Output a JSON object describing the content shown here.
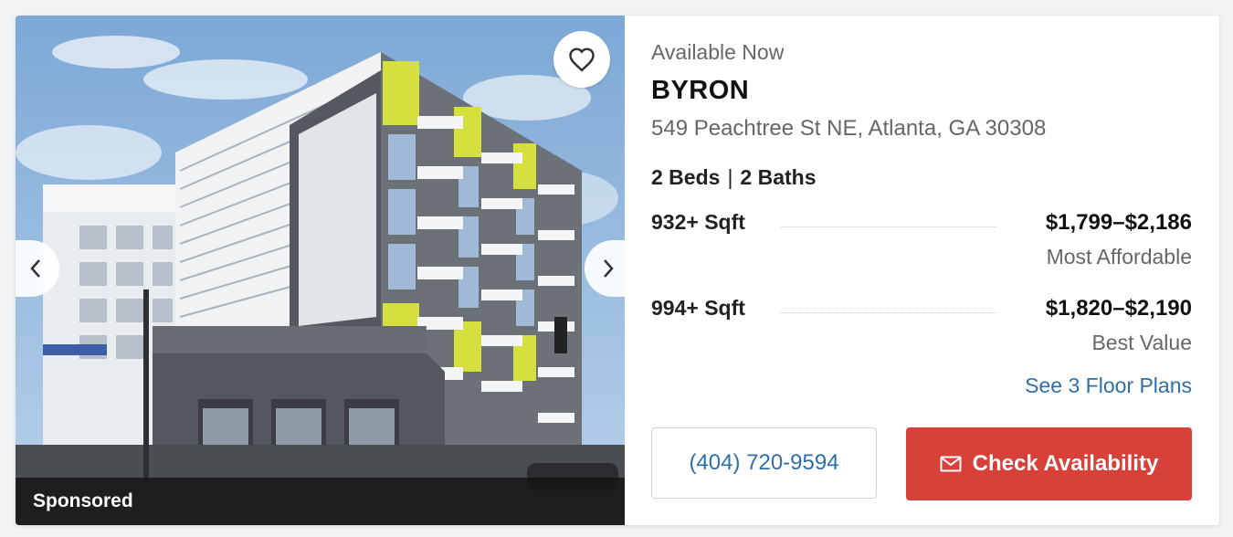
{
  "listing": {
    "availability": "Available Now",
    "name": "BYRON",
    "address": "549 Peachtree St NE, Atlanta, GA 30308",
    "beds": "2 Beds",
    "baths": "2 Baths",
    "bed_bath_separator": "|",
    "plans": [
      {
        "sqft": "932+ Sqft",
        "price": "$1,799–$2,186",
        "tag": "Most Affordable"
      },
      {
        "sqft": "994+ Sqft",
        "price": "$1,820–$2,190",
        "tag": "Best Value"
      }
    ],
    "floor_plans_link": "See 3 Floor Plans",
    "phone": "(404) 720-9594",
    "check_availability_label": "Check Availability"
  },
  "photo": {
    "badge": "Sponsored",
    "icons": {
      "favorite": "heart-outline-icon",
      "prev": "chevron-left-icon",
      "next": "chevron-right-icon",
      "mail": "envelope-icon"
    }
  },
  "colors": {
    "accent_red": "#d84139",
    "link_blue": "#2f6fa8",
    "text_muted": "#666666"
  }
}
